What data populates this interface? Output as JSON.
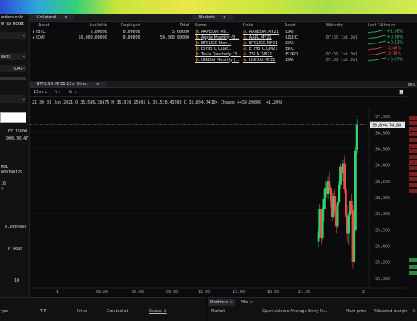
{
  "left_panel": {
    "orders_only": "orders only",
    "full_ticket": "w full ticket",
    "tracts": "racts",
    "asset": "tDAI",
    "prices": [
      "67.15000",
      "900.70147"
    ],
    "vals": [
      "001",
      "000190129",
      "16",
      "4"
    ],
    "v1": "0.9999999",
    "v2": "0.9999",
    "v3": "10"
  },
  "collateral": {
    "tab": "Collateral",
    "headers": [
      "Asset",
      "Available",
      "Deployed",
      "Total"
    ],
    "rows": [
      {
        "asset": "tBTC",
        "available": "5.00000",
        "deployed": "0.00000",
        "total": "5.00000"
      },
      {
        "asset": "tDAI",
        "available": "50,000.00000",
        "deployed": "0.00000",
        "total": "50,000.00000"
      }
    ]
  },
  "markets": {
    "tab": "Markets",
    "headers": [
      "Name",
      "Code",
      "Asset",
      "Maturity",
      "Last 24 hours"
    ],
    "rows": [
      {
        "name": "AAVEDAI Mo...",
        "code": "AAVEDAI.MF21",
        "asset": "tDAI",
        "maturity": "",
        "change": "+1.06%",
        "dir": "pos"
      },
      {
        "name": "Apple Monthly (3...",
        "code": "AAPL.MF21",
        "asset": "tUSDC",
        "maturity": "07:59 1st Jul",
        "change": "+0.38%",
        "dir": "pos"
      },
      {
        "name": "BTCUSD Mon...",
        "code": "BTCUSD.MF21",
        "asset": "tDAI",
        "maturity": "",
        "change": "+0.22%",
        "dir": "pos"
      },
      {
        "name": "ETHBTC Quar...",
        "code": "ETHBTC.QM21",
        "asset": "tBTC",
        "maturity": "",
        "change": "-0.46%",
        "dir": "neg"
      },
      {
        "name": "Tesla Quarterly (3...",
        "code": "TSLA.QM21",
        "asset": "tEURO",
        "maturity": "07:59 1st Jul",
        "change": "-0.38%",
        "dir": "neg"
      },
      {
        "name": "UNIDAI Monthly (...",
        "code": "UNIDAI.MF21",
        "asset": "tDAI",
        "maturity": "07:59 1st Jul",
        "change": "+0.07%",
        "dir": "pos"
      }
    ]
  },
  "chart_panel": {
    "tab": "BTCUSD.MF21 15m Chart",
    "interval": "15m",
    "ohlc": "21:30 01 Jun 2021  O 36,586.38475  H 36,970.15605  L 36,538.43983  C 36,894.74184  Change +439.00840 (+1.20%)",
    "price_label": "36,894.74184",
    "right_tab": "BTC"
  },
  "chart_data": {
    "type": "candlestick",
    "x_ticks": [
      "1",
      "03:00",
      "06:00",
      "09:00",
      "12:00",
      "15:00",
      "18:00",
      "21:00",
      "2"
    ],
    "y_ticks": [
      "37,000",
      "36,800",
      "36,600",
      "36,400",
      "36,200",
      "36,000",
      "35,800",
      "35,600",
      "35,400",
      "35,200",
      "35,000"
    ],
    "ylim": [
      34900,
      37120
    ],
    "last_price": 36894.74184,
    "candles": [
      [
        37.4,
        35460,
        35620,
        35380,
        35580
      ],
      [
        37.6,
        35580,
        35920,
        35500,
        35860
      ],
      [
        37.8,
        35860,
        35850,
        35420,
        35500
      ],
      [
        38.0,
        35500,
        35880,
        35470,
        35850
      ],
      [
        38.2,
        35850,
        36100,
        35700,
        35980
      ],
      [
        38.4,
        35980,
        36200,
        35850,
        36120
      ],
      [
        38.6,
        36120,
        36180,
        36000,
        36040
      ],
      [
        38.8,
        36040,
        36260,
        35980,
        36200
      ],
      [
        39.0,
        36200,
        36320,
        36080,
        36120
      ],
      [
        39.2,
        36120,
        36160,
        35880,
        35960
      ],
      [
        39.4,
        35960,
        36080,
        35700,
        35760
      ],
      [
        39.6,
        35760,
        36060,
        35740,
        36020
      ],
      [
        39.8,
        36020,
        36100,
        35800,
        35840
      ],
      [
        40.0,
        35840,
        35900,
        35560,
        35640
      ],
      [
        40.2,
        35640,
        36000,
        35620,
        35940
      ],
      [
        40.4,
        35940,
        36200,
        35900,
        36160
      ],
      [
        40.6,
        36160,
        36420,
        36100,
        36380
      ],
      [
        40.8,
        36380,
        36560,
        36300,
        36300
      ],
      [
        41.0,
        36300,
        36460,
        36200,
        36420
      ],
      [
        41.2,
        36420,
        36520,
        36060,
        36100
      ],
      [
        41.4,
        36100,
        36160,
        35700,
        35760
      ],
      [
        41.6,
        35760,
        35900,
        35460,
        35560
      ],
      [
        41.8,
        35560,
        35820,
        35420,
        35780
      ],
      [
        42.0,
        35780,
        36000,
        35700,
        35960
      ],
      [
        42.2,
        35960,
        36040,
        35800,
        35840
      ],
      [
        42.4,
        35840,
        35900,
        35120,
        35200
      ],
      [
        42.6,
        35200,
        35660,
        35000,
        35600
      ],
      [
        42.8,
        35600,
        36620,
        35580,
        36580
      ],
      [
        43.0,
        36586,
        36970,
        36538,
        36894
      ]
    ]
  },
  "positions_panel": {
    "tabs": [
      "Positions",
      "Fills"
    ],
    "headers": [
      "Market",
      "Open volume",
      "Average Entry Pr...",
      "Mark price",
      "Allocated margin",
      "U"
    ]
  },
  "orders_panel": {
    "headers": [
      "ype",
      "TIF",
      "Price",
      "Created at",
      "Status"
    ]
  },
  "colors": {
    "up": "#33d16b",
    "down": "#ef4b4b"
  }
}
